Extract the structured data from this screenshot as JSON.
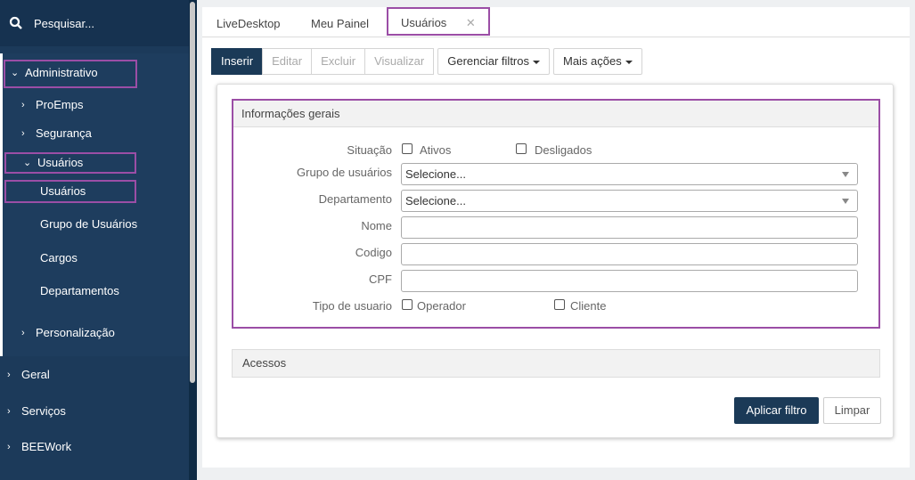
{
  "sidebar": {
    "search_label": "Pesquisar...",
    "administrativo": "Administrativo",
    "proemps": "ProEmps",
    "seguranca": "Segurança",
    "usuarios_group": "Usuários",
    "usuarios": "Usuários",
    "grupo_usuarios": "Grupo de Usuários",
    "cargos": "Cargos",
    "departamentos": "Departamentos",
    "personalizacao": "Personalização",
    "geral": "Geral",
    "servicos": "Serviços",
    "beework": "BEEWork"
  },
  "tabs": {
    "livedesktop": "LiveDesktop",
    "meu_painel": "Meu Painel",
    "usuarios": "Usuários",
    "close": "✕"
  },
  "toolbar": {
    "inserir": "Inserir",
    "editar": "Editar",
    "excluir": "Excluir",
    "visualizar": "Visualizar",
    "gerenciar": "Gerenciar filtros",
    "mais": "Mais ações"
  },
  "form": {
    "section_title": "Informações gerais",
    "situacao_label": "Situação",
    "ativos": "Ativos",
    "desligados": "Desligados",
    "grupo_label": "Grupo de usuários",
    "grupo_value": "Selecione...",
    "departamento_label": "Departamento",
    "departamento_value": "Selecione...",
    "nome_label": "Nome",
    "codigo_label": "Codigo",
    "cpf_label": "CPF",
    "tipo_label": "Tipo de usuario",
    "operador": "Operador",
    "cliente": "Cliente",
    "acessos_title": "Acessos",
    "aplicar": "Aplicar filtro",
    "limpar": "Limpar"
  },
  "colors": {
    "sidebar_bg": "#1c3a5a",
    "primary_button": "#1b3a57",
    "highlight": "#9b4ea6"
  }
}
